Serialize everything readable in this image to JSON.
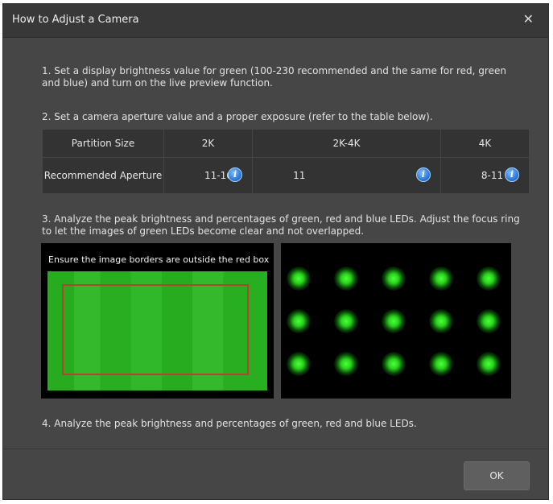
{
  "dialog": {
    "title": "How to Adjust a Camera",
    "close_glyph": "✕"
  },
  "steps": {
    "s1": "1. Set a display brightness value for green (100-230 recommended and the same for red, green and blue) and turn on the live preview function.",
    "s2": "2. Set a camera aperture value and a proper exposure (refer to the table below).",
    "s3": "3. Analyze the peak brightness and percentages of green, red and blue LEDs. Adjust the focus ring to let the images of green LEDs become clear and not overlapped.",
    "s4": "4. Analyze the peak brightness and percentages of green, red and blue LEDs."
  },
  "table": {
    "header_label": "Partition Size",
    "row_label": "Recommended Aperture",
    "columns": [
      {
        "size": "2K",
        "aperture": "11-16"
      },
      {
        "size": "2K-4K",
        "aperture": "11"
      },
      {
        "size": "4K",
        "aperture": "8-11"
      }
    ],
    "info_glyph": "i"
  },
  "preview": {
    "caption": "Ensure the image borders are outside the red box",
    "led_rows": 3,
    "led_cols": 5,
    "led_color": "#2ad41d",
    "box_color": "#b5452a"
  },
  "footer": {
    "ok_label": "OK"
  }
}
